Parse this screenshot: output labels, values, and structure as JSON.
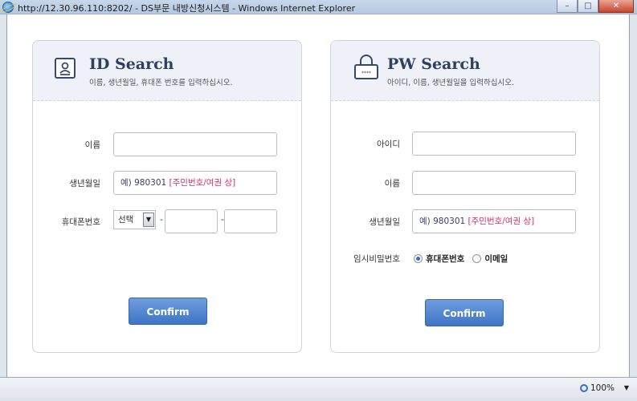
{
  "window": {
    "title": "http://12.30.96.110:8202/ - DS부문 내방신청시스템 - Windows Internet Explorer",
    "minimize": "–",
    "maximize": "□",
    "close": "✕"
  },
  "id_panel": {
    "title": "ID Search",
    "subtitle": "이름, 생년월일, 휴대폰 번호를 입력하십시오.",
    "name_label": "이름",
    "birth_label": "생년월일",
    "birth_hint_prefix": "예) 980301",
    "birth_hint_note": "[주민번호/여권 상]",
    "phone_label": "휴대폰번호",
    "phone_select": "선택",
    "dash": "-",
    "confirm": "Confirm"
  },
  "pw_panel": {
    "title": "PW Search",
    "subtitle": "아이디, 이름, 생년월일을 입력하십시오.",
    "id_label": "아이디",
    "name_label": "이름",
    "birth_label": "생년월일",
    "birth_hint_prefix": "예) 980301",
    "birth_hint_note": "[주민번호/여권 상]",
    "temp_pw_label": "임시비밀번호",
    "option_phone": "휴대폰번호",
    "option_email": "이메일",
    "selected_option": "휴대폰번호",
    "password_mask": "****",
    "confirm": "Confirm"
  },
  "statusbar": {
    "zoom": "100%",
    "zoom_arrow": "▼"
  },
  "colors": {
    "accent": "#3e74c4",
    "hint_note": "#d0306a",
    "header_bg": "#eef1f8"
  }
}
